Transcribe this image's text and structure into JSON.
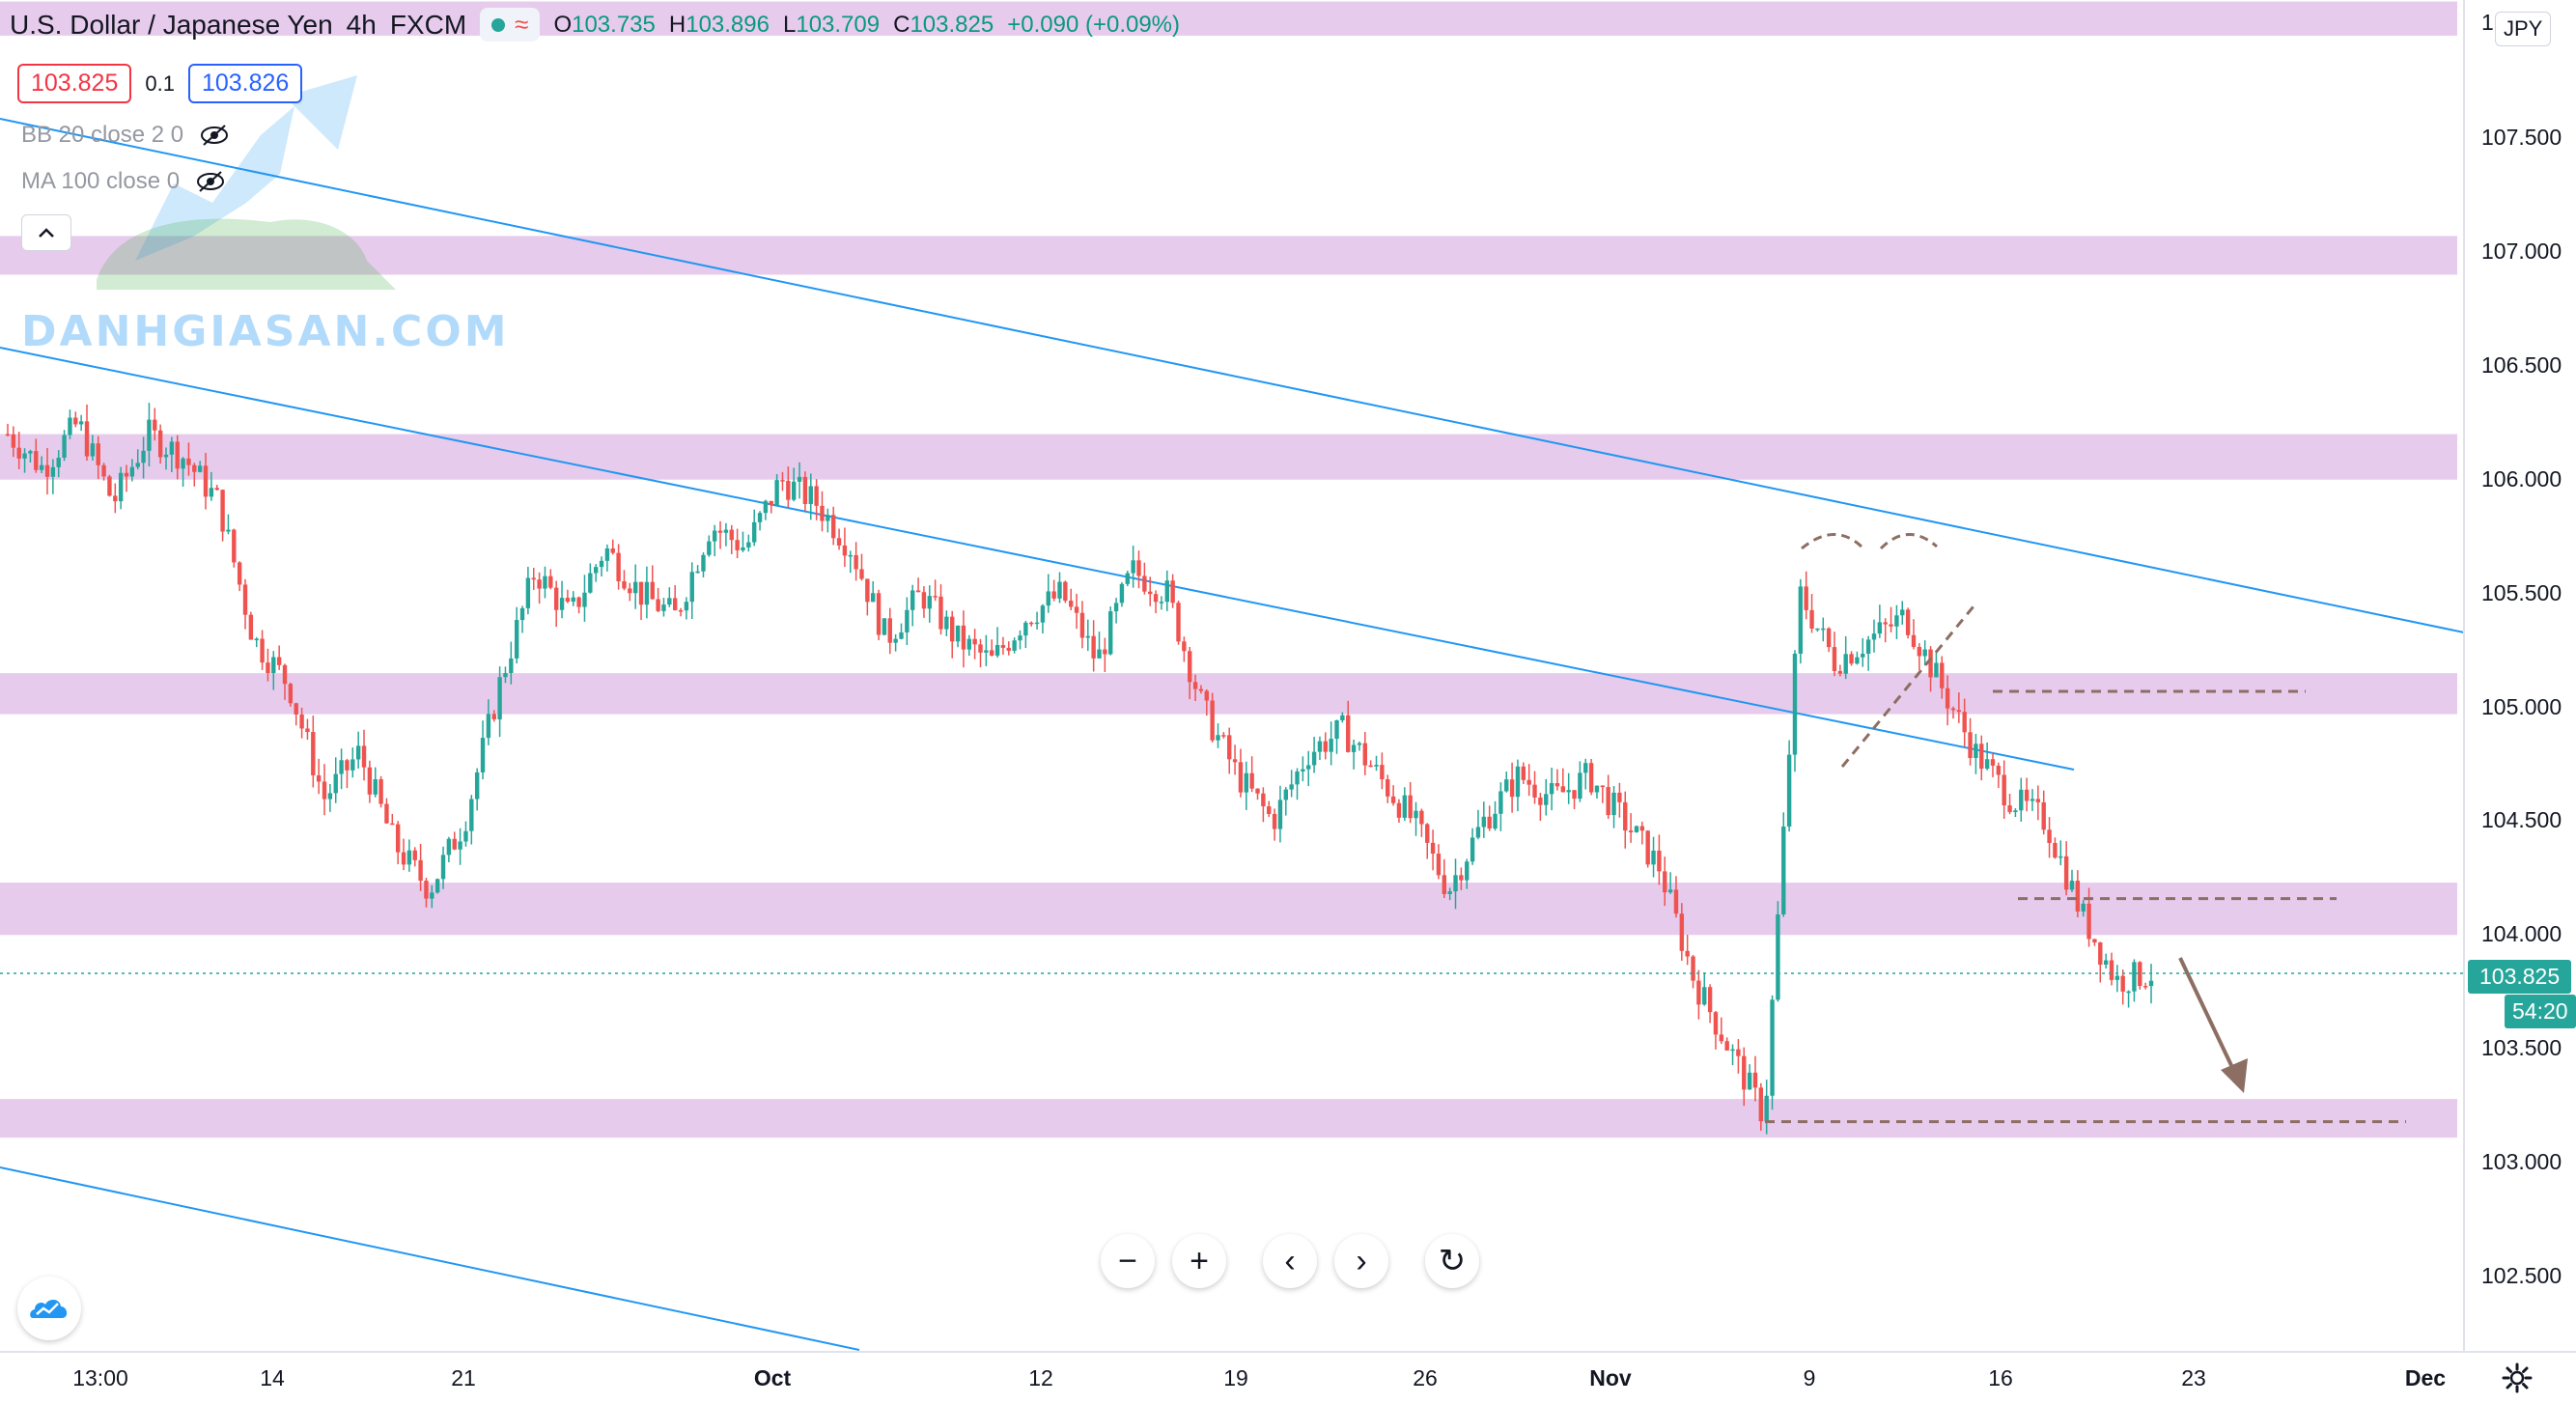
{
  "header": {
    "symbol_title": "U.S. Dollar / Japanese Yen",
    "interval": "4h",
    "exchange": "FXCM",
    "status_icons": [
      "market-open-dot",
      "wave-icon"
    ],
    "ohlc": {
      "o_label": "O",
      "o": "103.735",
      "h_label": "H",
      "h": "103.896",
      "l_label": "L",
      "l": "103.709",
      "c_label": "C",
      "c": "103.825",
      "change": "+0.090 (+0.09%)"
    }
  },
  "trade": {
    "bid": "103.825",
    "spread": "0.1",
    "ask": "103.826"
  },
  "indicators": [
    {
      "label": "BB 20 close 2 0",
      "icon": "eye-hidden-icon"
    },
    {
      "label": "MA 100 close 0",
      "icon": "eye-hidden-icon"
    }
  ],
  "watermark": {
    "text": "DANHGIASAN.COM"
  },
  "price_axis": {
    "currency": "JPY",
    "top_label_partial": "1",
    "labels": [
      "107.500",
      "107.000",
      "106.500",
      "106.000",
      "105.500",
      "105.000",
      "104.500",
      "104.000",
      "103.500",
      "103.000",
      "102.500"
    ],
    "current_price": "103.825",
    "countdown": "54:20"
  },
  "time_axis": {
    "labels": [
      "13:00",
      "14",
      "21",
      "Oct",
      "12",
      "19",
      "26",
      "Nov",
      "9",
      "16",
      "23",
      "Dec"
    ]
  },
  "controls": {
    "zoom_out": "−",
    "zoom_in": "+",
    "scroll_left": "‹",
    "scroll_right": "›",
    "reset": "↻"
  },
  "colors": {
    "up": "#26a69a",
    "down": "#ef5350",
    "trendline": "#2196f3",
    "zone": "#e1bee7",
    "annotation": "#8d6e63"
  },
  "chart_data": {
    "type": "candlestick",
    "symbol": "USDJPY",
    "interval": "4h",
    "ylim": [
      102.3,
      108.1
    ],
    "x_ticks": [
      "13:00",
      "14",
      "21",
      "Oct",
      "12",
      "19",
      "26",
      "Nov",
      "9",
      "16",
      "23",
      "Dec"
    ],
    "price_path": [
      [
        "Sep 10",
        106.2
      ],
      [
        "Sep 11",
        106.05
      ],
      [
        "Sep 12",
        106.25
      ],
      [
        "Sep 14",
        105.9
      ],
      [
        "Sep 15",
        106.2
      ],
      [
        "Sep 16",
        106.1
      ],
      [
        "Sep 17",
        105.9
      ],
      [
        "Sep 18",
        105.3
      ],
      [
        "Sep 20",
        105.1
      ],
      [
        "Sep 21",
        104.6
      ],
      [
        "Sep 22",
        104.8
      ],
      [
        "Sep 23",
        104.4
      ],
      [
        "Sep 24",
        104.2
      ],
      [
        "Sep 25",
        104.5
      ],
      [
        "Sep 27",
        105.1
      ],
      [
        "Sep 28",
        105.6
      ],
      [
        "Sep 29",
        105.4
      ],
      [
        "Sep 30",
        105.7
      ],
      [
        "Oct 1",
        105.5
      ],
      [
        "Oct 2",
        105.4
      ],
      [
        "Oct 4",
        105.8
      ],
      [
        "Oct 5",
        105.7
      ],
      [
        "Oct 6",
        106.0
      ],
      [
        "Oct 7",
        105.9
      ],
      [
        "Oct 8",
        105.7
      ],
      [
        "Oct 9",
        105.3
      ],
      [
        "Oct 11",
        105.5
      ],
      [
        "Oct 12",
        105.3
      ],
      [
        "Oct 13",
        105.2
      ],
      [
        "Oct 14",
        105.4
      ],
      [
        "Oct 15",
        105.5
      ],
      [
        "Oct 16",
        105.2
      ],
      [
        "Oct 18",
        105.6
      ],
      [
        "Oct 19",
        105.5
      ],
      [
        "Oct 20",
        105.0
      ],
      [
        "Oct 21",
        104.7
      ],
      [
        "Oct 22",
        104.5
      ],
      [
        "Oct 23",
        104.8
      ],
      [
        "Oct 25",
        104.9
      ],
      [
        "Oct 26",
        104.7
      ],
      [
        "Oct 27",
        104.5
      ],
      [
        "Oct 28",
        104.2
      ],
      [
        "Oct 29",
        104.5
      ],
      [
        "Oct 30",
        104.7
      ],
      [
        "Nov 1",
        104.6
      ],
      [
        "Nov 2",
        104.7
      ],
      [
        "Nov 3",
        104.5
      ],
      [
        "Nov 4",
        104.3
      ],
      [
        "Nov 5",
        103.8
      ],
      [
        "Nov 6",
        103.5
      ],
      [
        "Nov 8",
        103.2
      ],
      [
        "Nov 9",
        105.5
      ],
      [
        "Nov 10",
        105.2
      ],
      [
        "Nov 11",
        105.3
      ],
      [
        "Nov 12",
        105.4
      ],
      [
        "Nov 13",
        105.1
      ],
      [
        "Nov 15",
        104.8
      ],
      [
        "Nov 16",
        104.6
      ],
      [
        "Nov 17",
        104.5
      ],
      [
        "Nov 18",
        104.1
      ],
      [
        "Nov 19",
        103.8
      ],
      [
        "Nov 20",
        103.83
      ]
    ],
    "zones": [
      {
        "from": 107.95,
        "to": 108.1
      },
      {
        "from": 106.9,
        "to": 107.07
      },
      {
        "from": 106.0,
        "to": 106.2
      },
      {
        "from": 104.97,
        "to": 105.15
      },
      {
        "from": 104.0,
        "to": 104.23
      },
      {
        "from": 103.11,
        "to": 103.28
      }
    ],
    "dashed_levels": [
      105.07,
      104.16,
      103.18
    ]
  }
}
